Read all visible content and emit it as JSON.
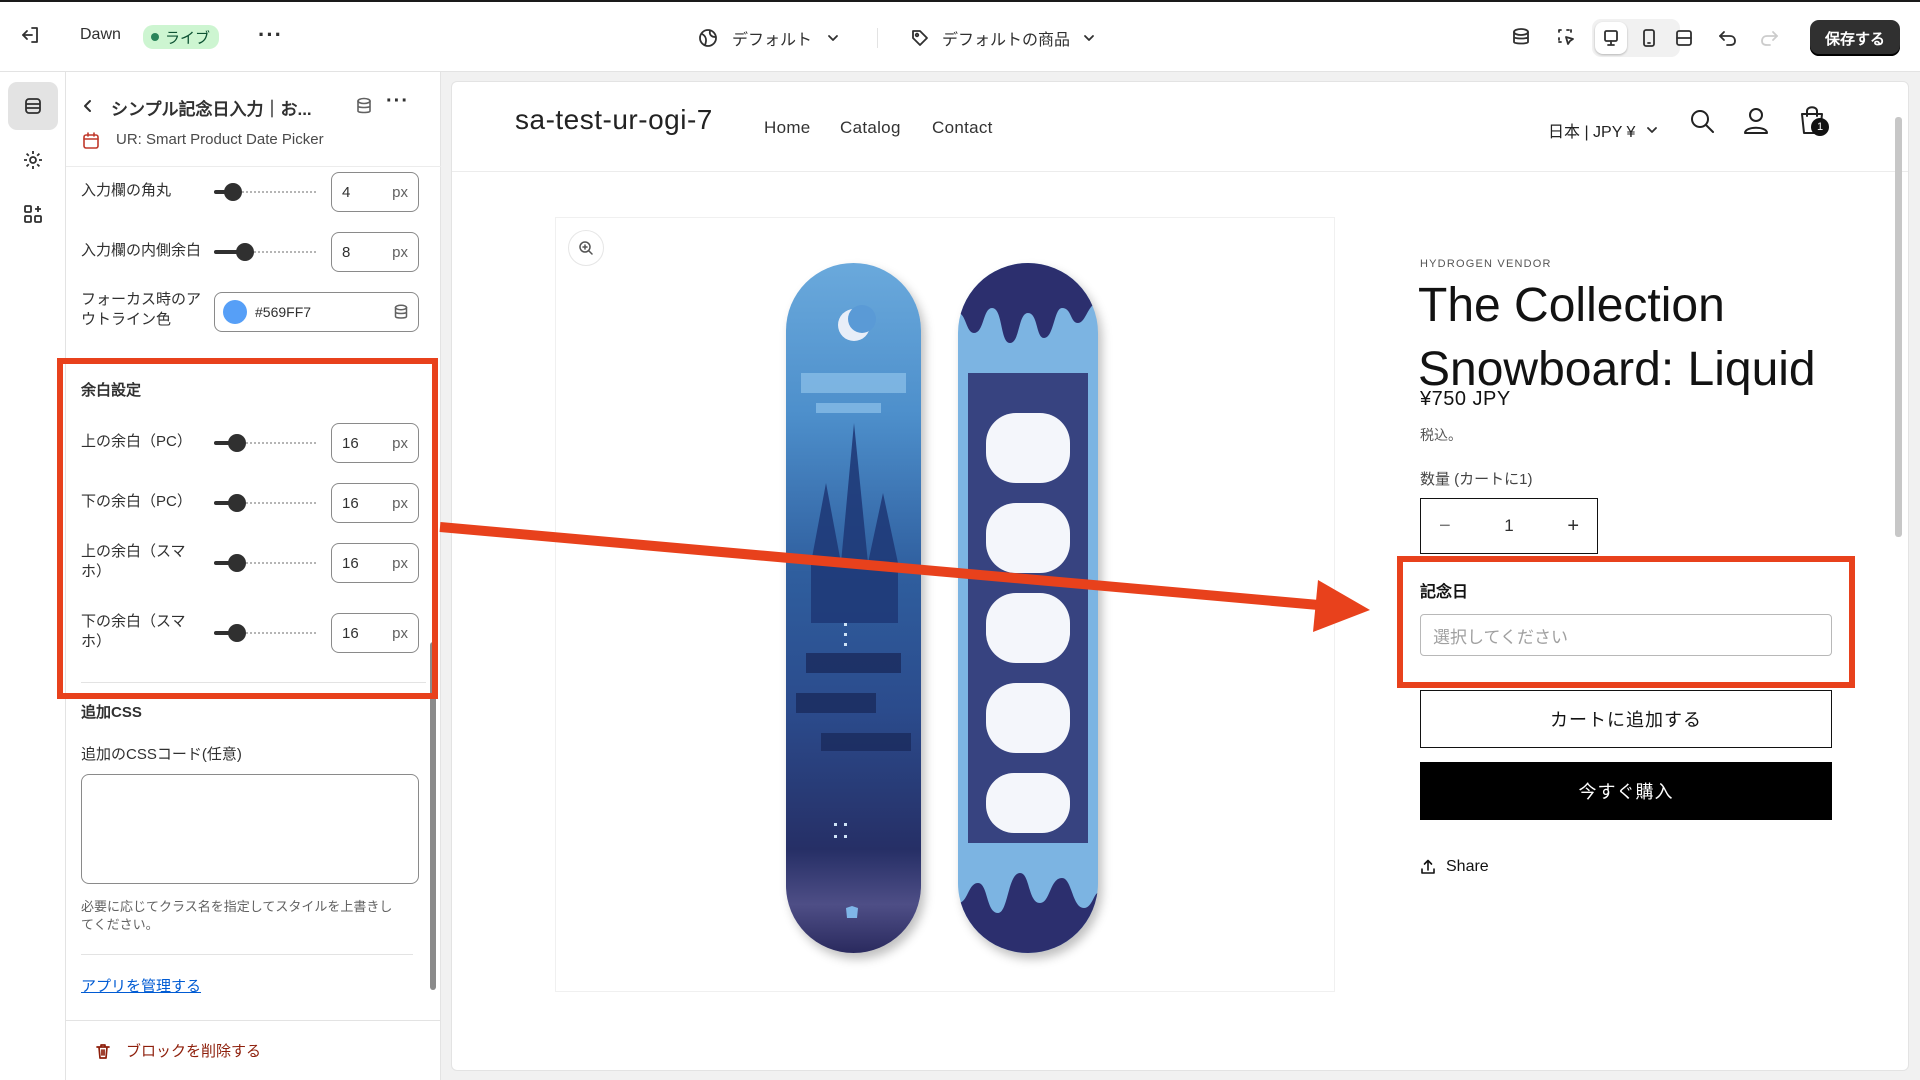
{
  "topbar": {
    "theme_name": "Dawn",
    "live_badge": "ライブ",
    "template_selector": "デフォルト",
    "product_selector": "デフォルトの商品",
    "save_label": "保存する"
  },
  "panel": {
    "block_title": "シンプル記念日入力｜お...",
    "app_name": "UR: Smart Product Date Picker",
    "settings": [
      {
        "label": "入力欄の角丸",
        "value": "4",
        "unit": "px"
      },
      {
        "label": "入力欄の内側余白",
        "value": "8",
        "unit": "px"
      },
      {
        "label_line1": "フォーカス時のア",
        "label_line2": "ウトライン色",
        "color_value": "#569FF7"
      }
    ],
    "spacing_section": {
      "heading": "余白設定",
      "rows": [
        {
          "label_line1": "上の余白（PC）",
          "label_line2": "",
          "value": "16",
          "unit": "px"
        },
        {
          "label_line1": "下の余白（PC）",
          "label_line2": "",
          "value": "16",
          "unit": "px"
        },
        {
          "label_line1": "上の余白（スマ",
          "label_line2": "ホ）",
          "value": "16",
          "unit": "px"
        },
        {
          "label_line1": "下の余白（スマ",
          "label_line2": "ホ）",
          "value": "16",
          "unit": "px"
        }
      ]
    },
    "css_section": {
      "heading": "追加CSS",
      "field_label": "追加のCSSコード(任意)",
      "textarea_value": "",
      "help_line1": "必要に応じてクラス名を指定してスタイルを上書きし",
      "help_line2": "てください。"
    },
    "manage_app_link": "アプリを管理する",
    "delete_block": "ブロックを削除する"
  },
  "store": {
    "name": "sa-test-ur-ogi-7",
    "nav": [
      "Home",
      "Catalog",
      "Contact"
    ],
    "locale": "日本 | JPY ¥",
    "cart_count": "1"
  },
  "product": {
    "vendor": "HYDROGEN VENDOR",
    "title_line1": "The Collection",
    "title_line2": "Snowboard: Liquid",
    "price": "¥750 JPY",
    "tax_note": "税込。",
    "quantity_label": "数量 (カートに1)",
    "quantity_value": "1",
    "date_label": "記念日",
    "date_placeholder": "選択してください",
    "add_to_cart": "カートに追加する",
    "buy_now": "今すぐ購入",
    "share": "Share"
  },
  "colors": {
    "annotation": "#e8411c",
    "focus_outline": "#569FF7",
    "live_badge_bg": "#cdf5d1"
  }
}
